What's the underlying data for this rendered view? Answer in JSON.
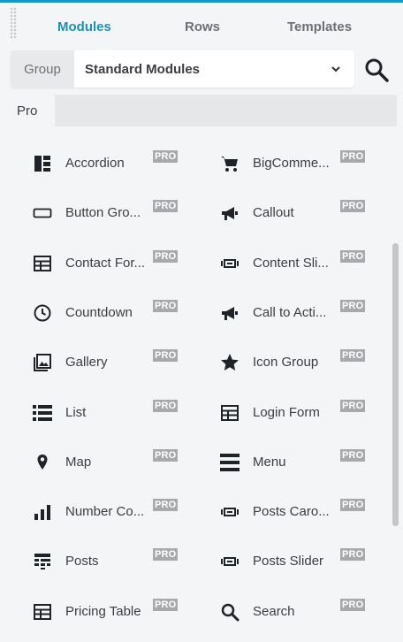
{
  "tabs": [
    {
      "label": "Modules"
    },
    {
      "label": "Rows"
    },
    {
      "label": "Templates"
    }
  ],
  "group": {
    "label": "Group",
    "selected": "Standard Modules"
  },
  "section": {
    "label": "Pro"
  },
  "colors": {
    "accent": "#1e8fb5",
    "badge": "#a7a9ac"
  },
  "modules": [
    {
      "label": "Accordion",
      "badge": "PRO",
      "icon": "accordion-icon"
    },
    {
      "label": "BigComme...",
      "badge": "PRO",
      "icon": "cart-icon"
    },
    {
      "label": "Button Gro...",
      "badge": "PRO",
      "icon": "button-group-icon"
    },
    {
      "label": "Callout",
      "badge": "PRO",
      "icon": "megaphone-icon"
    },
    {
      "label": "Contact For...",
      "badge": "PRO",
      "icon": "form-table-icon"
    },
    {
      "label": "Content Sli...",
      "badge": "PRO",
      "icon": "slider-icon"
    },
    {
      "label": "Countdown",
      "badge": "PRO",
      "icon": "clock-icon"
    },
    {
      "label": "Call to Acti...",
      "badge": "PRO",
      "icon": "megaphone-icon"
    },
    {
      "label": "Gallery",
      "badge": "PRO",
      "icon": "gallery-icon"
    },
    {
      "label": "Icon Group",
      "badge": "PRO",
      "icon": "star-icon"
    },
    {
      "label": "List",
      "badge": "PRO",
      "icon": "list-icon"
    },
    {
      "label": "Login Form",
      "badge": "PRO",
      "icon": "form-table-icon"
    },
    {
      "label": "Map",
      "badge": "PRO",
      "icon": "map-pin-icon"
    },
    {
      "label": "Menu",
      "badge": "PRO",
      "icon": "menu-icon"
    },
    {
      "label": "Number Co...",
      "badge": "PRO",
      "icon": "bar-chart-icon"
    },
    {
      "label": "Posts Caro...",
      "badge": "PRO",
      "icon": "slider-icon"
    },
    {
      "label": "Posts",
      "badge": "PRO",
      "icon": "posts-grid-icon"
    },
    {
      "label": "Posts Slider",
      "badge": "PRO",
      "icon": "slider-icon"
    },
    {
      "label": "Pricing Table",
      "badge": "PRO",
      "icon": "form-table-icon"
    },
    {
      "label": "Search",
      "badge": "PRO",
      "icon": "search-icon"
    }
  ]
}
